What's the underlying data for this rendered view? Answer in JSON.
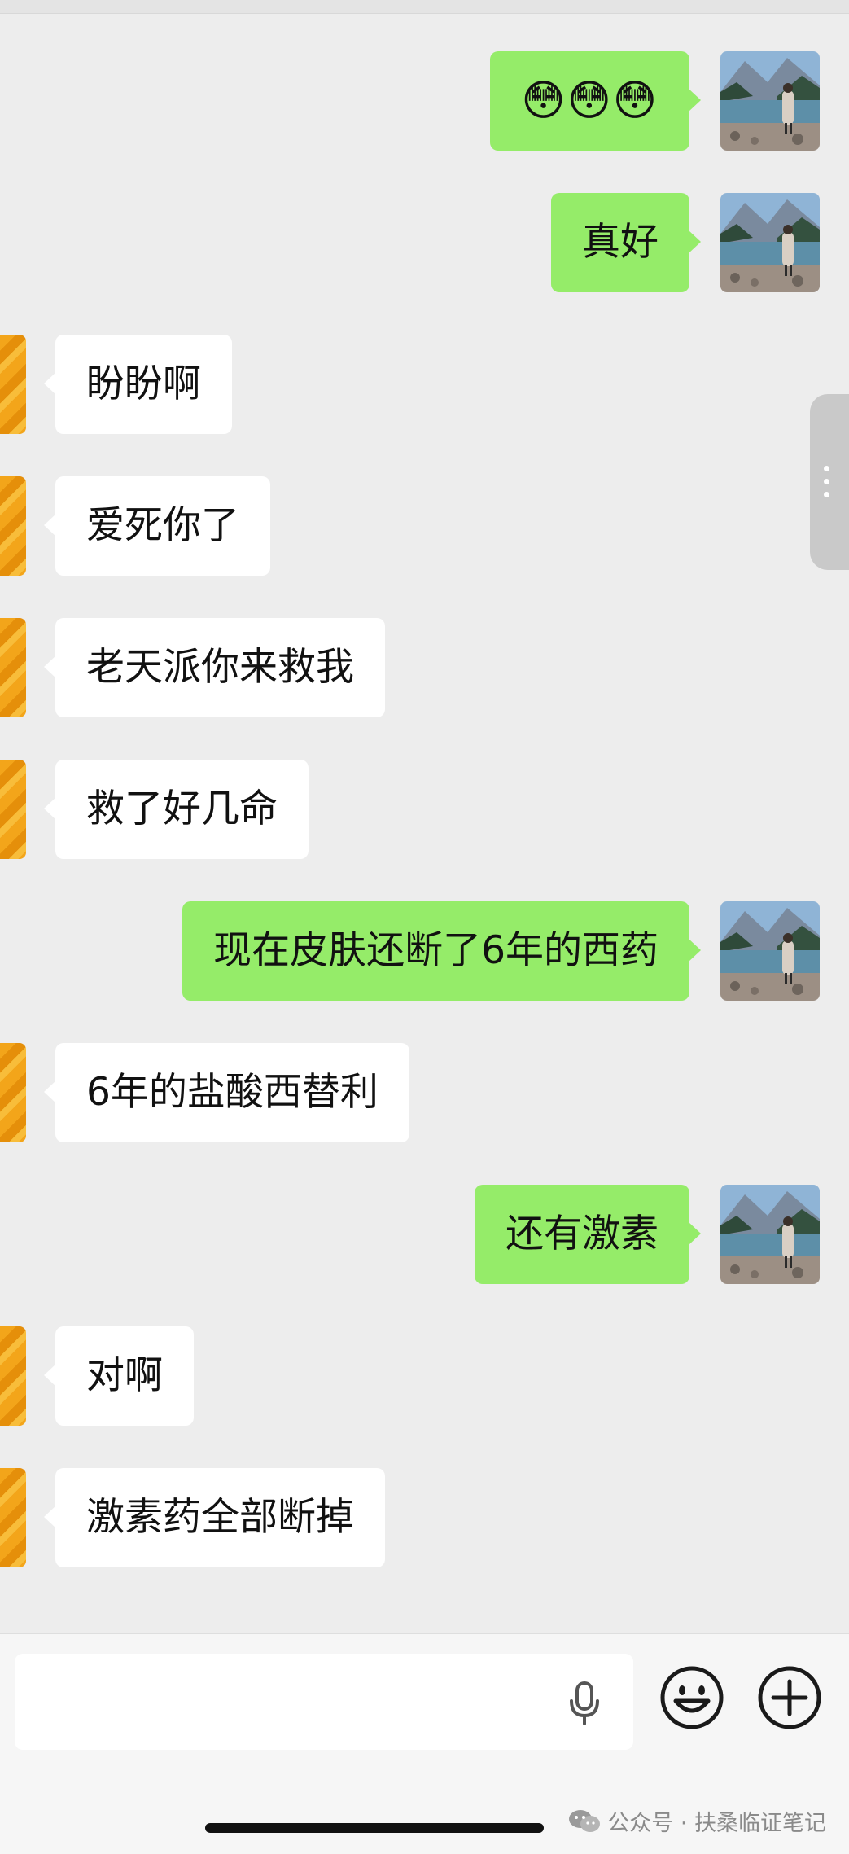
{
  "chat": {
    "messages": [
      {
        "side": "right",
        "text": "😳😳😳"
      },
      {
        "side": "right",
        "text": "真好"
      },
      {
        "side": "left",
        "text": "盼盼啊"
      },
      {
        "side": "left",
        "text": "爱死你了"
      },
      {
        "side": "left",
        "text": "老天派你来救我"
      },
      {
        "side": "left",
        "text": "救了好几命"
      },
      {
        "side": "right",
        "text": "现在皮肤还断了6年的西药"
      },
      {
        "side": "left",
        "text": "6年的盐酸西替利"
      },
      {
        "side": "right",
        "text": "还有激素"
      },
      {
        "side": "left",
        "text": "对啊"
      },
      {
        "side": "left",
        "text": "激素药全部断掉"
      }
    ]
  },
  "footer": {
    "watermark": "公众号 · 扶桑临证笔记"
  },
  "icons": {
    "mic": "microphone-icon",
    "emoji": "smiley-icon",
    "plus": "plus-circle-icon",
    "wechat": "wechat-logo-icon"
  },
  "colors": {
    "background": "#ededed",
    "self_bubble": "#95ec69",
    "other_bubble": "#ffffff"
  }
}
